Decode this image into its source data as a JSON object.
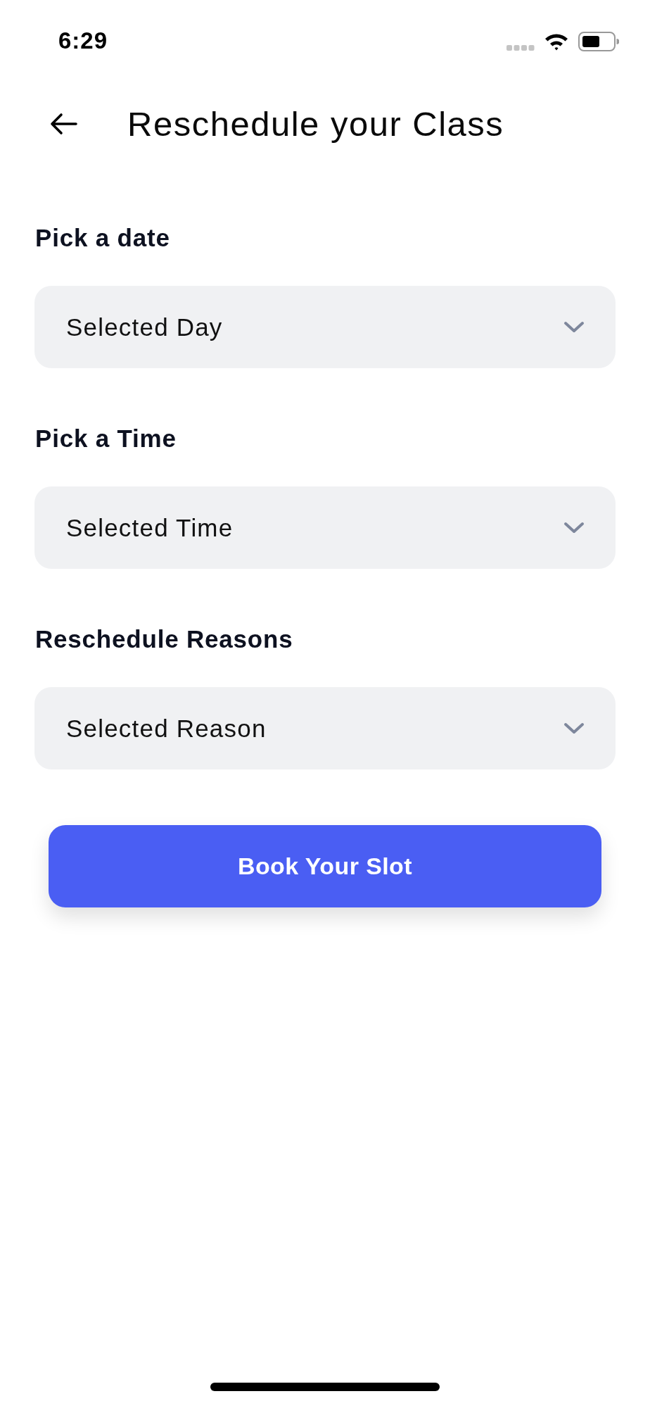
{
  "status_bar": {
    "time": "6:29"
  },
  "header": {
    "title": "Reschedule your Class"
  },
  "fields": [
    {
      "label": "Pick a date",
      "value": "Selected Day"
    },
    {
      "label": "Pick a Time",
      "value": "Selected Time"
    },
    {
      "label": "Reschedule Reasons",
      "value": "Selected Reason"
    }
  ],
  "primary_button": {
    "label": "Book Your Slot"
  }
}
